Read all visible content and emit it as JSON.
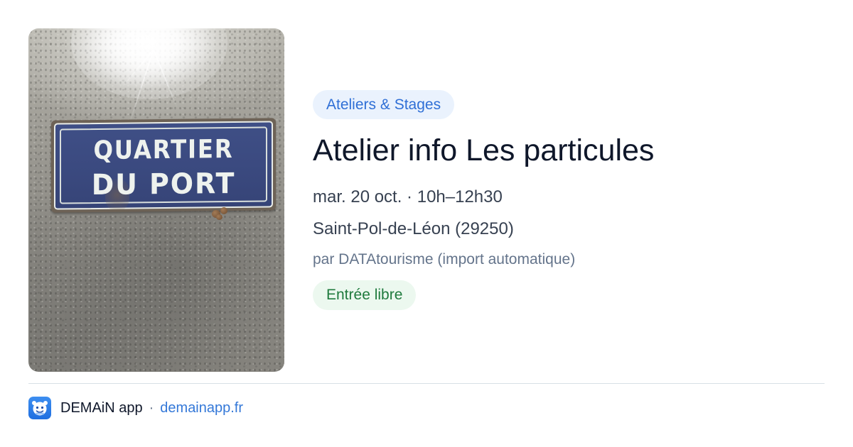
{
  "photo": {
    "sign_line1": "QUARTIER",
    "sign_line2": "DU PORT"
  },
  "event": {
    "category": "Ateliers & Stages",
    "title": "Atelier info Les particules",
    "datetime": "mar. 20 oct. · 10h–12h30",
    "location": "Saint-Pol-de-Léon (29250)",
    "organizer": "par DATAtourisme (import automatique)",
    "price": "Entrée libre"
  },
  "footer": {
    "app_icon": "demain-app-icon",
    "app_name": "DEMAiN app",
    "separator": "·",
    "domain": "demainapp.fr"
  },
  "colors": {
    "category_chip_bg": "#eaf2fd",
    "category_chip_text": "#2f6fd6",
    "price_chip_bg": "#ecf8ef",
    "price_chip_text": "#1f7a3d",
    "link": "#3478d8",
    "title": "#0f172a",
    "muted": "#64748b"
  }
}
